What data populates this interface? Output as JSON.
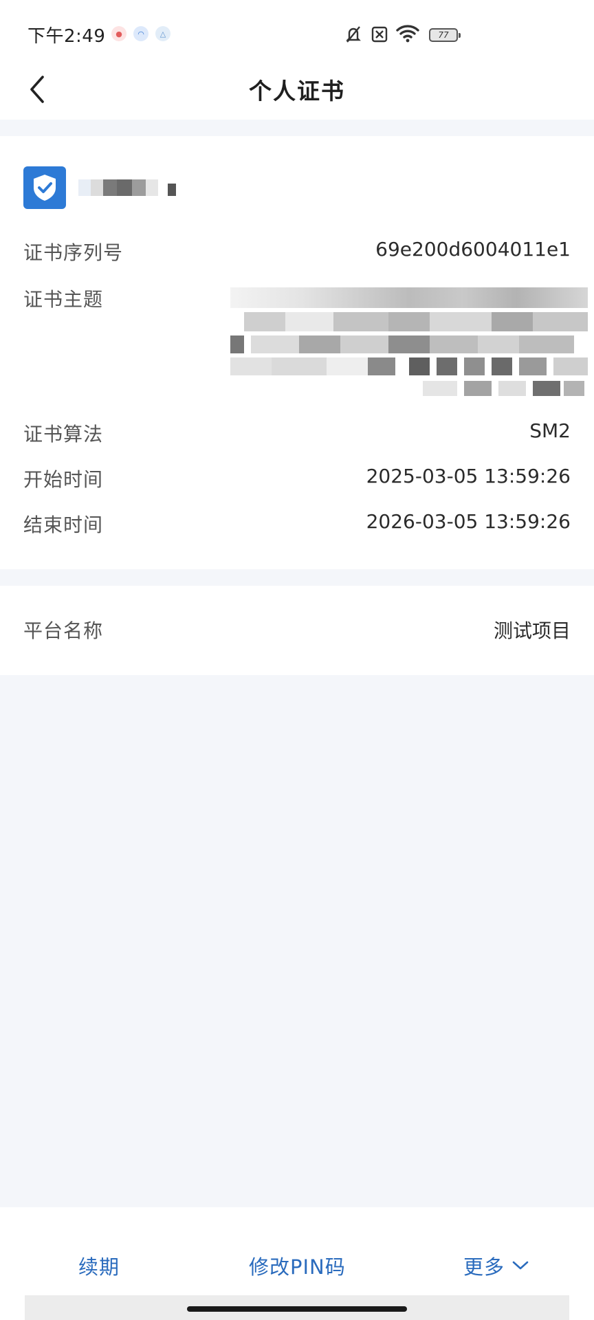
{
  "status_bar": {
    "time": "下午2:49",
    "battery": "77"
  },
  "nav": {
    "title": "个人证书"
  },
  "certificate": {
    "rows": [
      {
        "label": "证书序列号",
        "value": "69e200d6004011e1"
      },
      {
        "label": "证书主题",
        "value": ""
      },
      {
        "label": "证书算法",
        "value": "SM2"
      },
      {
        "label": "开始时间",
        "value": "2025-03-05 13:59:26"
      },
      {
        "label": "结束时间",
        "value": "2026-03-05 13:59:26"
      }
    ]
  },
  "platform": {
    "label": "平台名称",
    "value": "测试项目"
  },
  "actions": {
    "renew": "续期",
    "change_pin": "修改PIN码",
    "more": "更多"
  },
  "colors": {
    "accent": "#2a6bbd",
    "shield": "#2d7ad6",
    "page_bg": "#f4f6fa"
  },
  "icons": [
    "back-arrow-icon",
    "shield-check-icon",
    "mute-icon",
    "sim-icon",
    "wifi-icon",
    "battery-icon",
    "chevron-down-icon"
  ]
}
